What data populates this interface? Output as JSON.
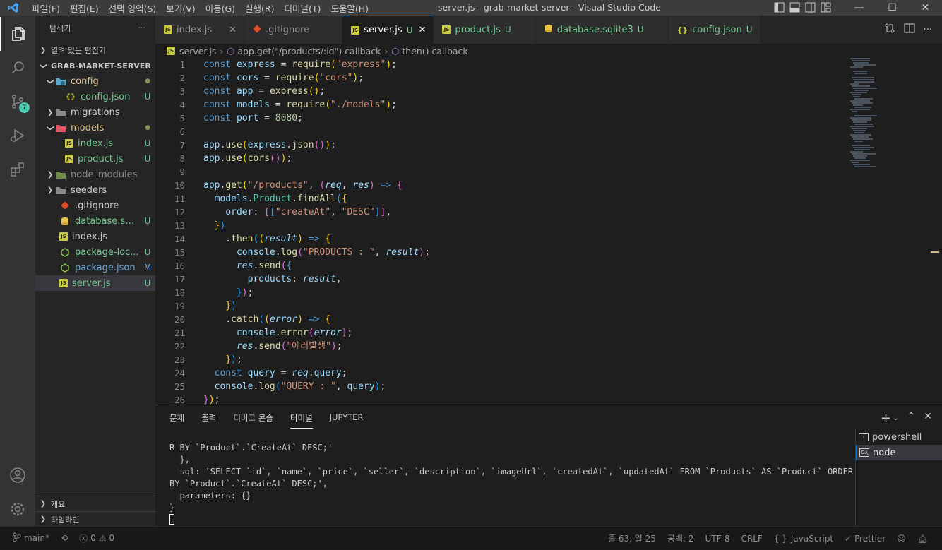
{
  "titlebar": {
    "title": "server.js - grab-market-server - Visual Studio Code",
    "menu": [
      "파일(F)",
      "편집(E)",
      "선택 영역(S)",
      "보기(V)",
      "이동(G)",
      "실행(R)",
      "터미널(T)",
      "도움말(H)"
    ],
    "minimize": "—",
    "maximize": "☐",
    "close": "✕"
  },
  "activity": {
    "scm_badge": "7"
  },
  "sidebar": {
    "title": "탐색기",
    "more": "···",
    "open_editors": "열려 있는 편집기",
    "folder": "GRAB-MARKET-SERVER",
    "items": [
      {
        "label": "config",
        "status": "●"
      },
      {
        "label": "config.json",
        "status": "U"
      },
      {
        "label": "migrations",
        "status": ""
      },
      {
        "label": "models",
        "status": "●"
      },
      {
        "label": "index.js",
        "status": "U"
      },
      {
        "label": "product.js",
        "status": "U"
      },
      {
        "label": "node_modules",
        "status": ""
      },
      {
        "label": "seeders",
        "status": ""
      },
      {
        "label": ".gitignore",
        "status": ""
      },
      {
        "label": "database.sqli...",
        "status": "U"
      },
      {
        "label": "index.js",
        "status": ""
      },
      {
        "label": "package-loc...",
        "status": "U"
      },
      {
        "label": "package.json",
        "status": "M"
      },
      {
        "label": "server.js",
        "status": "U"
      }
    ],
    "outline": "개요",
    "timeline": "타임라인"
  },
  "tabs": [
    {
      "label": "index.js",
      "status": "",
      "close": "✕"
    },
    {
      "label": ".gitignore",
      "status": "",
      "close": ""
    },
    {
      "label": "server.js",
      "status": "U",
      "close": "✕"
    },
    {
      "label": "product.js",
      "status": "U",
      "close": ""
    },
    {
      "label": "database.sqlite3",
      "status": "U",
      "close": ""
    },
    {
      "label": "config.json",
      "status": "U",
      "close": ""
    }
  ],
  "breadcrumb": {
    "file": "server.js",
    "b1": "app.get(\"/products/:id\") callback",
    "b2": "then() callback"
  },
  "editor": {
    "line_numbers": [
      "1",
      "2",
      "3",
      "4",
      "5",
      "6",
      "7",
      "8",
      "9",
      "10",
      "11",
      "12",
      "13",
      "14",
      "15",
      "16",
      "17",
      "18",
      "19",
      "20",
      "21",
      "22",
      "23",
      "24",
      "25",
      "26"
    ]
  },
  "panel": {
    "tabs": [
      "문제",
      "출력",
      "디버그 콘솔",
      "터미널",
      "JUPYTER"
    ],
    "terminal_lines": [
      "R BY `Product`.`CreateAt` DESC;'",
      "  },",
      "  sql: 'SELECT `id`, `name`, `price`, `seller`, `description`, `imageUrl`, `createdAt`, `updatedAt` FROM `Products` AS `Product` ORDER",
      "BY `Product`.`CreateAt` DESC;',",
      "  parameters: {}",
      "}"
    ],
    "terminals": [
      "powershell",
      "node"
    ]
  },
  "status": {
    "branch": "main*",
    "errors": "0",
    "warnings": "0",
    "position": "줄 63, 열 25",
    "spaces": "공백: 2",
    "encoding": "UTF-8",
    "eol": "CRLF",
    "language": "JavaScript",
    "prettier": "Prettier"
  }
}
